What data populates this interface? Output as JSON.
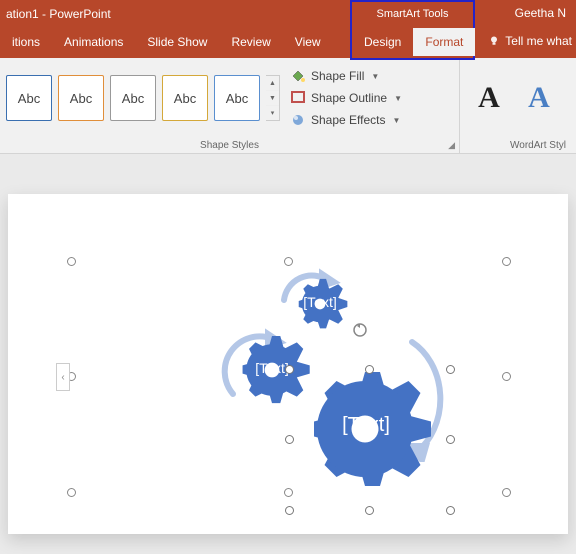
{
  "titlebar": {
    "title": "ation1 - PowerPoint",
    "user": "Geetha N"
  },
  "tool_context": {
    "title": "SmartArt Tools",
    "design": "Design",
    "format": "Format"
  },
  "tabs": {
    "transitions": "itions",
    "animations": "Animations",
    "slideshow": "Slide Show",
    "review": "Review",
    "view": "View",
    "tellme": "Tell me what"
  },
  "ribbon": {
    "shape_styles": {
      "label": "Shape Styles",
      "thumb_text": "Abc",
      "fill": "Shape Fill",
      "outline": "Shape Outline",
      "effects": "Shape Effects"
    },
    "wordart": {
      "label": "WordArt Styl",
      "sample": "A"
    }
  },
  "smartart": {
    "placeholder": "[Text]",
    "expand_glyph": "‹"
  }
}
